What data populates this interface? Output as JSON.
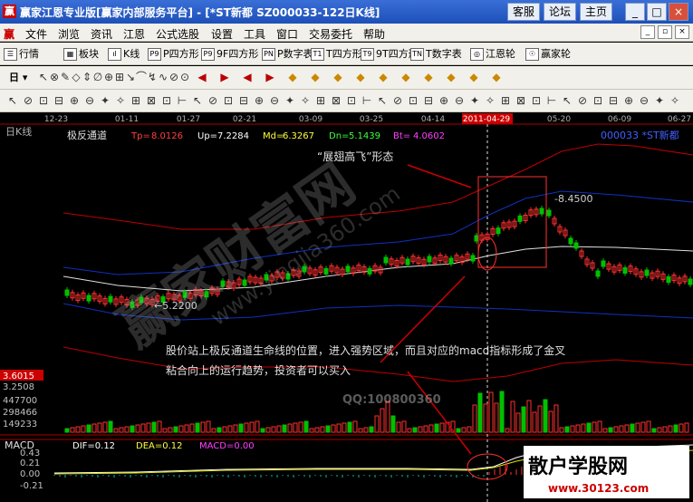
{
  "title": {
    "logo": "赢",
    "text": "赢家江恩专业版[赢家内部服务平台] - [*ST新都    SZ000033-122日K线]",
    "buttons": [
      "客服",
      "论坛",
      "主页"
    ],
    "win": [
      "_",
      "□",
      "×"
    ]
  },
  "menu": {
    "items": [
      "文件",
      "浏览",
      "资讯",
      "江恩",
      "公式选股",
      "设置",
      "工具",
      "窗口",
      "交易委托",
      "帮助"
    ],
    "mdi": [
      "_",
      "▫",
      "×"
    ]
  },
  "toolbar1": [
    "行情",
    "板块",
    "K线",
    "P四方形",
    "9F四方形",
    "P数字表",
    "T四方形",
    "9T四方形",
    "T数字表",
    "江恩轮",
    "赢家轮"
  ],
  "toolbar1_icons": [
    "☰",
    "▦",
    "ıl",
    "P9",
    "P9",
    "PN",
    "T1",
    "T9",
    "TN",
    "◎",
    "☉"
  ],
  "toolbar2_sel": "日",
  "toolbar2": [
    "↖",
    "⊗",
    "✎",
    "◇",
    "⇕",
    "∅",
    "⊕",
    "⊞",
    "↘",
    "⌒",
    "↯",
    "∿",
    "⊘",
    "⊙"
  ],
  "toolbar3": [
    "↖",
    "⊘",
    "⊡",
    "⊟",
    "⊕",
    "⊖",
    "✦",
    "✧",
    "⊞",
    "⊠",
    "⊡",
    "⊢"
  ],
  "chart": {
    "period": "日K线",
    "dates": [
      "12-23",
      "01-11",
      "01-27",
      "02-21",
      "03-09",
      "03-25",
      "04-14",
      "2011-04-29",
      "05-20",
      "06-09",
      "06-27"
    ],
    "indicator": {
      "name": "极反通道",
      "items": [
        {
          "k": "Tp=",
          "v": "8.0126"
        },
        {
          "k": "Up=",
          "v": "7.2284"
        },
        {
          "k": "Md=",
          "v": "6.3267"
        },
        {
          "k": "Dn=",
          "v": "5.1439"
        },
        {
          "k": "Bt=",
          "v": "4.0602"
        }
      ]
    },
    "stock": "000033 *ST新都",
    "pattern": "“展翅高飞”形态",
    "hi_label": "8.4500",
    "lo_label": "5.2200",
    "price_tag": "3.6015",
    "price_low": "3.2508",
    "vol_ticks": [
      "447700",
      "298466",
      "149233"
    ],
    "annotation": [
      "股价站上极反通道生命线的位置，进入强势区域，而且对应的macd指标形成了金叉",
      "粘合向上的运行趋势，投资者可以买入"
    ],
    "watermark": [
      "赢家财富网",
      "www.yingjia360.com",
      "QQ:100800360"
    ],
    "macd": {
      "name": "MACD",
      "dif": "DIF=0.12",
      "dea": "DEA=0.12",
      "macd": "MACD=0.00",
      "ticks": [
        "0.43",
        "0.21",
        "0.00",
        "-0.21"
      ]
    },
    "site": {
      "name": "散户学股网",
      "url": "www.30123.com"
    }
  }
}
